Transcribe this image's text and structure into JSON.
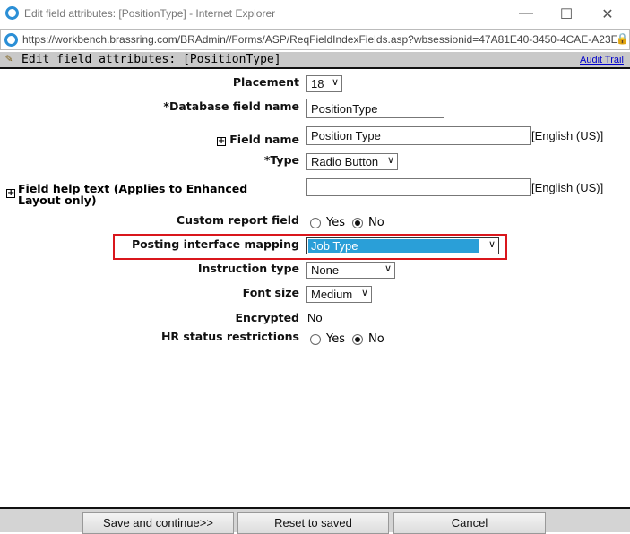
{
  "window": {
    "title": "Edit field attributes: [PositionType] - Internet Explorer",
    "url": "https://workbench.brassring.com/BRAdmin//Forms/ASP/ReqFieldIndexFields.asp?wbsessionid=47A81E40-3450-4CAE-A23E-"
  },
  "header": {
    "title": "Edit field attributes: [PositionType]",
    "audit_trail": "Audit Trail"
  },
  "form": {
    "placement": {
      "label": "Placement",
      "value": "18"
    },
    "db_field_name": {
      "label": "*Database field name",
      "value": "PositionType"
    },
    "field_name": {
      "label": "Field name",
      "value": "Position Type",
      "lang": "[English (US)]"
    },
    "type": {
      "label": "*Type",
      "value": "Radio Button"
    },
    "help_text": {
      "label": "Field help text (Applies to Enhanced Layout only)",
      "value": "",
      "lang": "[English (US)]"
    },
    "custom_report": {
      "label": "Custom report field",
      "yes": "Yes",
      "no": "No",
      "selected": "No"
    },
    "posting_mapping": {
      "label": "Posting interface mapping",
      "value": "Job Type"
    },
    "instruction_type": {
      "label": "Instruction type",
      "value": "None"
    },
    "font_size": {
      "label": "Font size",
      "value": "Medium"
    },
    "encrypted": {
      "label": "Encrypted",
      "value": "No"
    },
    "hr_status": {
      "label": "HR status restrictions",
      "yes": "Yes",
      "no": "No",
      "selected": "No"
    }
  },
  "footer": {
    "save": "Save and continue>>",
    "reset": "Reset to saved",
    "cancel": "Cancel"
  },
  "colors": {
    "highlight": "#2a9fd8",
    "mapping_border": "#d9161c",
    "link": "#0000cc"
  }
}
